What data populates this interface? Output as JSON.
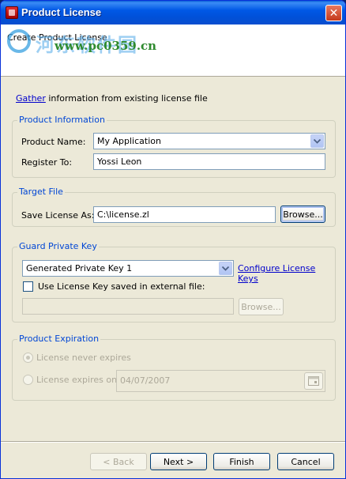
{
  "window": {
    "title": "Product License",
    "subtitle": "Create Product License",
    "close_glyph": "✕"
  },
  "watermark": {
    "chinese_text": "河东软件园",
    "url": "www.pc0359.cn"
  },
  "gather": {
    "link_label": "Gather",
    "rest_text": " information from existing license file"
  },
  "product_information": {
    "title": "Product Information",
    "product_name_label": "Product Name:",
    "product_name_value": "My Application",
    "register_to_label": "Register To:",
    "register_to_value": "Yossi Leon"
  },
  "target_file": {
    "title": "Target File",
    "save_label": "Save License As:",
    "save_value": "C:\\license.zl",
    "browse_label": "Browse..."
  },
  "guard_private_key": {
    "title": "Guard Private Key",
    "key_value": "Generated Private Key 1",
    "configure_link": "Configure License Keys",
    "external_checkbox_label": "Use License Key saved in external file:",
    "external_checked": false,
    "external_path_value": "",
    "browse_label": "Browse..."
  },
  "product_expiration": {
    "title": "Product Expiration",
    "never_expires_label": "License never expires",
    "expires_on_label": "License expires on:",
    "selected": "never",
    "date_value": "04/07/2007"
  },
  "buttons": {
    "back": "< Back",
    "next": "Next >",
    "finish": "Finish",
    "cancel": "Cancel"
  },
  "icons": {
    "app": "product-license-icon",
    "close": "close-icon",
    "combo": "chevron-down-icon",
    "calendar": "calendar-icon"
  },
  "colors": {
    "titlebar": "#0058e6",
    "window_bg": "#ece9d8",
    "group_title": "#0046d5",
    "link": "#0000cc"
  }
}
